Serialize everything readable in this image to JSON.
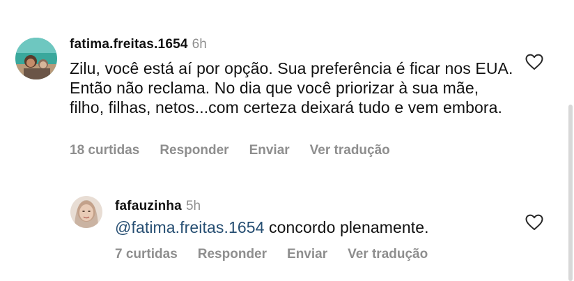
{
  "comments": [
    {
      "username": "fatima.freitas.1654",
      "time": "6h",
      "text": "Zilu, você está aí por opção. Sua preferência é ficar nos EUA. Então não reclama. No dia que você priorizar à sua mãe, filho, filhas, netos...com certeza deixará tudo e vem embora.",
      "likes": "18 curtidas",
      "reply": "Responder",
      "send": "Enviar",
      "translate": "Ver tradução",
      "heart_icon": "heart-outline-icon"
    }
  ],
  "replies": [
    {
      "username": "fafauzinha",
      "time": "5h",
      "mention": "@fatima.freitas.1654",
      "text": " concordo plenamente.",
      "likes": "7 curtidas",
      "reply": "Responder",
      "send": "Enviar",
      "translate": "Ver tradução",
      "heart_icon": "heart-outline-icon"
    }
  ],
  "colors": {
    "mention": "#264e72",
    "secondary_text": "#8e8e8e"
  }
}
